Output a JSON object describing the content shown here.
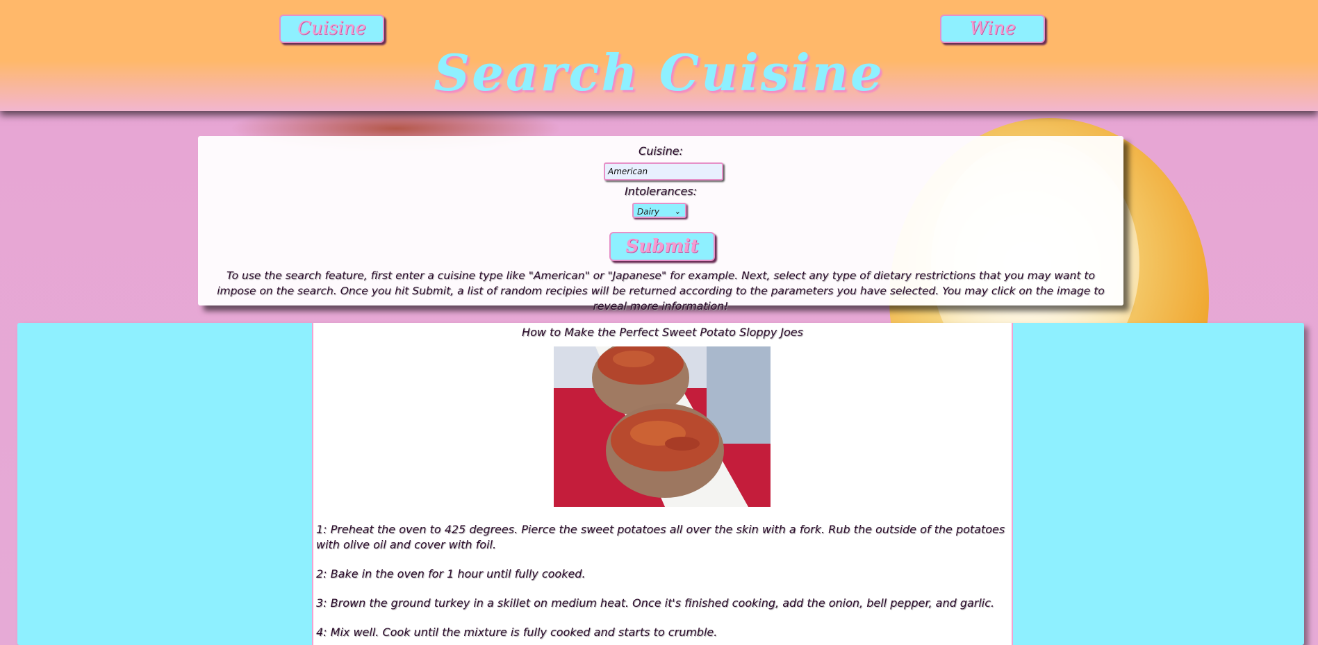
{
  "nav": {
    "cuisine_label": "Cuisine",
    "wine_label": "Wine"
  },
  "header": {
    "title": "Search Cuisine"
  },
  "form": {
    "cuisine_label": "Cuisine:",
    "cuisine_value": "American",
    "intolerances_label": "Intolerances:",
    "intolerances_selected": "Dairy",
    "submit_label": "Submit",
    "instructions": "To use the search feature, first enter a cuisine type like \"American\" or \"Japanese\" for example. Next, select any type of dietary restrictions that you may want to impose on the search. Once you hit Submit, a list of random recipies will be returned according to the parameters you have selected. You may click on the image to reveal more information!"
  },
  "recipe": {
    "title": "How to Make the Perfect Sweet Potato Sloppy Joes",
    "steps": [
      "1: Preheat the oven to 425 degrees. Pierce the sweet potatoes all over the skin with a fork. Rub the outside of the potatoes with olive oil and cover with foil.",
      "2: Bake in the oven for 1 hour until fully cooked.",
      "3: Brown the ground turkey in a skillet on medium heat. Once it's finished cooking, add the onion, bell pepper, and garlic.",
      "4: Mix well. Cook until the mixture is fully cooked and starts to crumble."
    ]
  },
  "colors": {
    "header_orange": "#ffb86a",
    "accent_cyan": "#8ef0ff",
    "accent_pink": "#e690c8",
    "background_pink": "#e9aad6"
  }
}
